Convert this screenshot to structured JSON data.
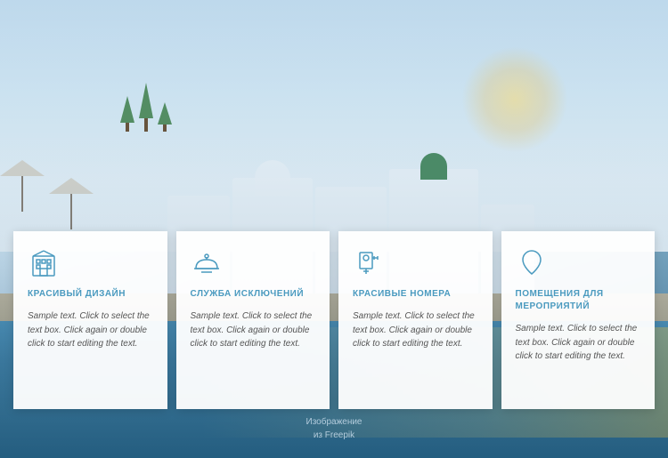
{
  "background": {
    "image_credit_line1": "Изображение",
    "image_credit_line2": "из Freepik"
  },
  "cards": [
    {
      "id": "card-1",
      "icon": "building-icon",
      "title": "КРАСИВЫЙ ДИЗАЙН",
      "text": "Sample text. Click to select the text box. Click again or double click to start editing the text."
    },
    {
      "id": "card-2",
      "icon": "service-icon",
      "title": "СЛУЖБА ИСКЛЮЧЕНИЙ",
      "text": "Sample text. Click to select the text box. Click again or double click to start editing the text."
    },
    {
      "id": "card-3",
      "icon": "rooms-icon",
      "title": "КРАСИВЫЕ НОМЕРА",
      "text": "Sample text. Click to select the text box. Click again or double click to start editing the text."
    },
    {
      "id": "card-4",
      "icon": "events-icon",
      "title": "ПОМЕЩЕНИЯ ДЛЯ МЕРОПРИЯТИЙ",
      "text": "Sample text. Click to select the text box. Click again or double click to start editing the text."
    }
  ],
  "colors": {
    "accent": "#4a9abf",
    "card_bg": "rgba(255,255,255,0.95)",
    "title_color": "#4a9abf",
    "text_color": "#555555"
  }
}
